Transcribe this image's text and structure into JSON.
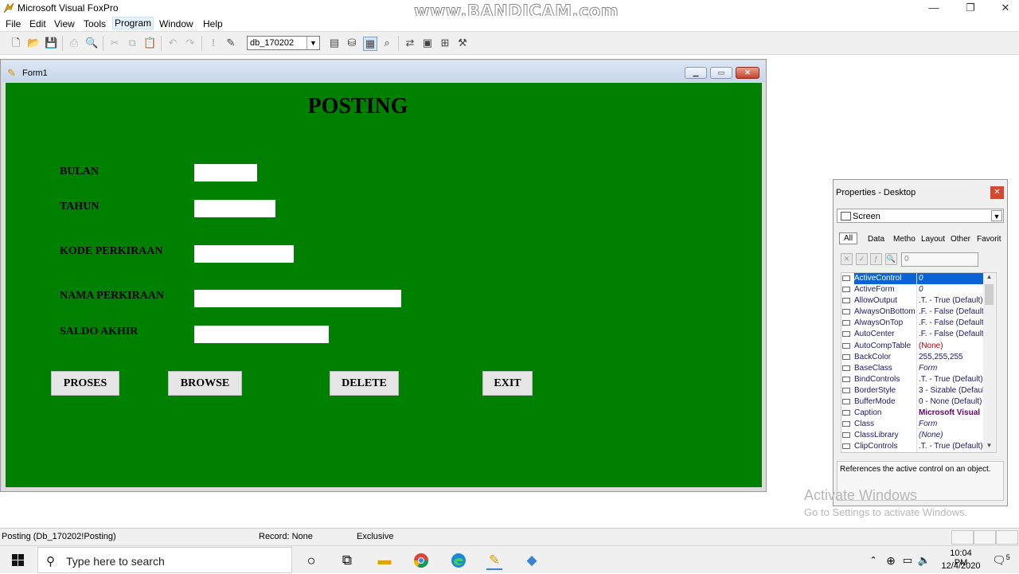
{
  "app": {
    "title": "Microsoft Visual FoxPro",
    "watermark": "www.BANDICAM.com",
    "window_controls": {
      "minimize": "—",
      "maximize": "❐",
      "close": "✕"
    }
  },
  "menu": {
    "items": [
      "File",
      "Edit",
      "View",
      "Tools",
      "Program",
      "Window",
      "Help"
    ],
    "active": "Program"
  },
  "toolbar": {
    "database_combo": "db_170202"
  },
  "form": {
    "title": "Form1",
    "heading": "POSTING",
    "background": "#008000",
    "fields": [
      {
        "label": "BULAN",
        "value": ""
      },
      {
        "label": "TAHUN",
        "value": ""
      },
      {
        "label": "KODE PERKIRAAN",
        "value": ""
      },
      {
        "label": "NAMA PERKIRAAN",
        "value": ""
      },
      {
        "label": "SALDO AKHIR",
        "value": ""
      }
    ],
    "buttons": [
      "PROSES",
      "BROWSE",
      "DELETE",
      "EXIT"
    ]
  },
  "properties": {
    "title": "Properties - Desktop",
    "object": "Screen",
    "tabs": [
      "All",
      "Data",
      "Metho",
      "Layout",
      "Other",
      "Favorit"
    ],
    "active_tab": "All",
    "value_input": "0",
    "rows": [
      {
        "name": "ActiveControl",
        "value": "0",
        "style": "ital",
        "selected": true
      },
      {
        "name": "ActiveForm",
        "value": "0",
        "style": "ital"
      },
      {
        "name": "AllowOutput",
        "value": ".T. - True (Default)"
      },
      {
        "name": "AlwaysOnBottom",
        "value": ".F. - False (Default)"
      },
      {
        "name": "AlwaysOnTop",
        "value": ".F. - False (Default)"
      },
      {
        "name": "AutoCenter",
        "value": ".F. - False (Default)"
      },
      {
        "name": "AutoCompTable",
        "value": "(None)",
        "style": "red"
      },
      {
        "name": "BackColor",
        "value": "255,255,255"
      },
      {
        "name": "BaseClass",
        "value": "Form",
        "style": "ital"
      },
      {
        "name": "BindControls",
        "value": ".T. - True (Default)"
      },
      {
        "name": "BorderStyle",
        "value": "3 - Sizable (Default)"
      },
      {
        "name": "BufferMode",
        "value": "0 - None (Default)"
      },
      {
        "name": "Caption",
        "value": "Microsoft Visual",
        "style": "bold"
      },
      {
        "name": "Class",
        "value": "Form",
        "style": "ital"
      },
      {
        "name": "ClassLibrary",
        "value": "(None)",
        "style": "ital"
      },
      {
        "name": "ClipControls",
        "value": ".T. - True (Default)"
      }
    ],
    "description": "References the active control on an object."
  },
  "activation": {
    "title": "Activate Windows",
    "subtitle": "Go to Settings to activate Windows."
  },
  "status": {
    "left": "Posting (Db_170202!Posting)",
    "record": "Record: None",
    "mode": "Exclusive"
  },
  "taskbar": {
    "search_placeholder": "Type here to search",
    "time": "10:04 PM",
    "date": "12/4/2020",
    "notifications": "5"
  }
}
